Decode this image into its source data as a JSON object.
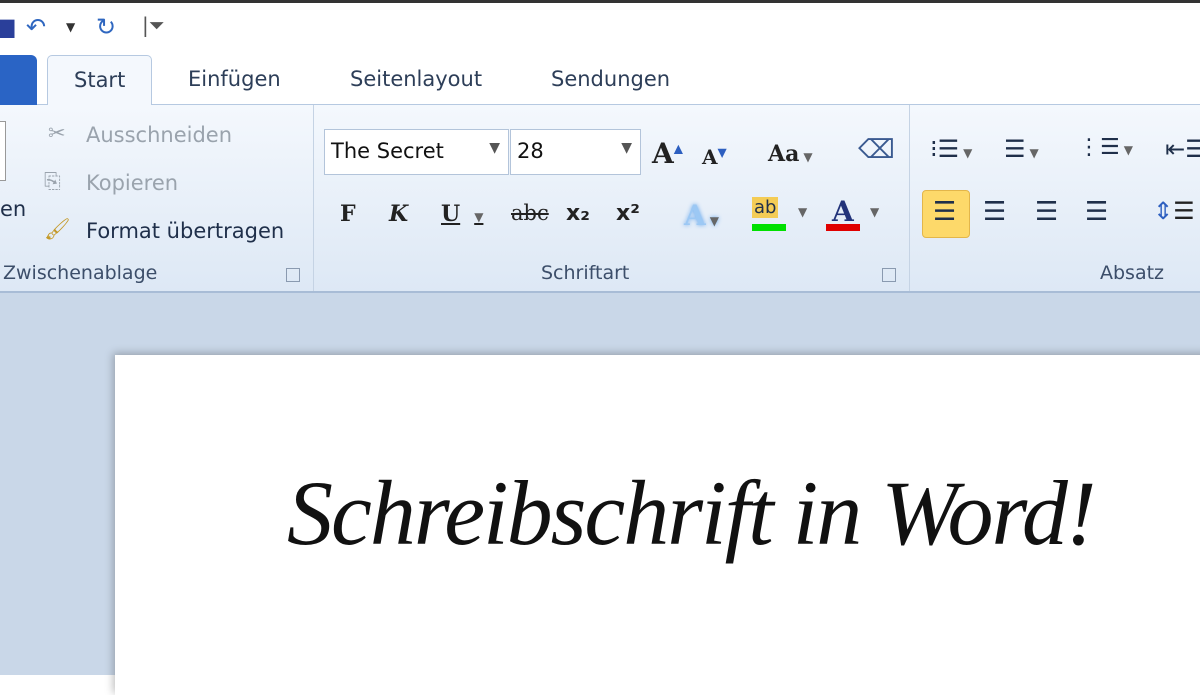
{
  "quick_access": {
    "save_icon": "save-icon",
    "undo_icon": "undo-icon",
    "redo_icon": "redo-icon",
    "customize_icon": "customize-icon"
  },
  "tabs": [
    {
      "label": "Start",
      "active": true
    },
    {
      "label": "Einfügen"
    },
    {
      "label": "Seitenlayout"
    },
    {
      "label": "Sendungen"
    }
  ],
  "clipboard": {
    "paste_partial": "en",
    "cut": "Ausschneiden",
    "copy": "Kopieren",
    "format_painter": "Format übertragen",
    "group": "Zwischenablage"
  },
  "font": {
    "name": "The Secret",
    "size": "28",
    "bold": "F",
    "italic": "K",
    "underline": "U",
    "strike": "abc",
    "subscript": "x₂",
    "superscript": "x²",
    "grow": "A",
    "shrink": "A",
    "case": "Aa",
    "group": "Schriftart",
    "highlight_color": "#00e000",
    "font_color": "#e00000"
  },
  "paragraph": {
    "group": "Absatz",
    "active_alignment": "left"
  },
  "document": {
    "text": "Schreibschrift in Word!"
  }
}
